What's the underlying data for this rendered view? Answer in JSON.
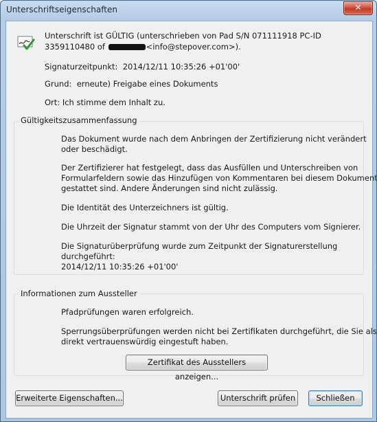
{
  "window": {
    "title": "Unterschriftseigenschaften",
    "close_glyph": "✕"
  },
  "signature": {
    "status_line1": "Unterschrift ist GÜLTIG (unterschrieben von Pad S/N 071111918 PC-ID",
    "status_line2_prefix": "3359110480 of",
    "status_line2_suffix": "<info@stepover.com>).",
    "time_label": "Signaturzeitpunkt:",
    "time_value": "2014/12/11 10:35:26 +01'00'",
    "reason_label": "Grund:",
    "reason_value": "erneute) Freigabe eines Dokuments",
    "location_label": "Ort:",
    "location_value": "Ich stimme dem Inhalt zu."
  },
  "validity": {
    "heading": "Gültigkeitszusammenfassung",
    "p1_line1": "Das Dokument wurde nach dem Anbringen der Zertifizierung nicht verändert",
    "p1_line2": "oder beschädigt.",
    "p2_line1": "Der Zertifizierer hat festgelegt, dass das Ausfüllen und Unterschreiben von",
    "p2_line2": "Formularfeldern sowie das Hinzufügen von Kommentaren bei diesem Dokument",
    "p2_line3": "gestattet sind. Andere Änderungen sind nicht zulässig.",
    "p3": "Die Identität des Unterzeichners ist gültig.",
    "p4": "Die Uhrzeit der Signatur stammt von der Uhr des Computers vom Signierer.",
    "p5_line1": "Die Signaturüberprüfung wurde zum Zeitpunkt der Signaturerstellung",
    "p5_line2": "durchgeführt:",
    "p5_line3": "2014/12/11 10:35:26 +01'00'"
  },
  "issuer": {
    "heading": "Informationen zum Aussteller",
    "p1": "Pfadprüfungen waren erfolgreich.",
    "p2_line1": "Sperrungsüberprüfungen werden nicht bei Zertifikaten durchgeführt, die Sie als",
    "p2_line2": "direkt vertrauenswürdig eingestuft haben.",
    "show_cert_button": "Zertifikat des Ausstellers anzeigen..."
  },
  "buttons": {
    "advanced": "Erweiterte Eigenschaften...",
    "validate": "Unterschrift prüfen",
    "close": "Schließen"
  },
  "icons": {
    "signature_status": "signature-valid-icon"
  }
}
